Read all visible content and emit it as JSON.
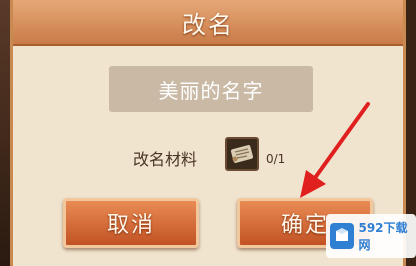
{
  "dialog": {
    "title": "改名",
    "name_value": "美丽的名字",
    "material_label": "改名材料",
    "material_icon": "scroll-icon",
    "material_count": "0/1",
    "cancel_label": "取消",
    "confirm_label": "确定"
  },
  "annotation": {
    "arrow_icon": "red-arrow-icon",
    "arrow_color": "#e0201e"
  },
  "watermark": {
    "text": "592下载网",
    "logo_icon": "box-logo-icon"
  },
  "colors": {
    "title_bar": "#d68d5a",
    "dialog_bg": "#f0e4cf",
    "button": "#d8693a",
    "name_box": "#c9b9a5"
  }
}
